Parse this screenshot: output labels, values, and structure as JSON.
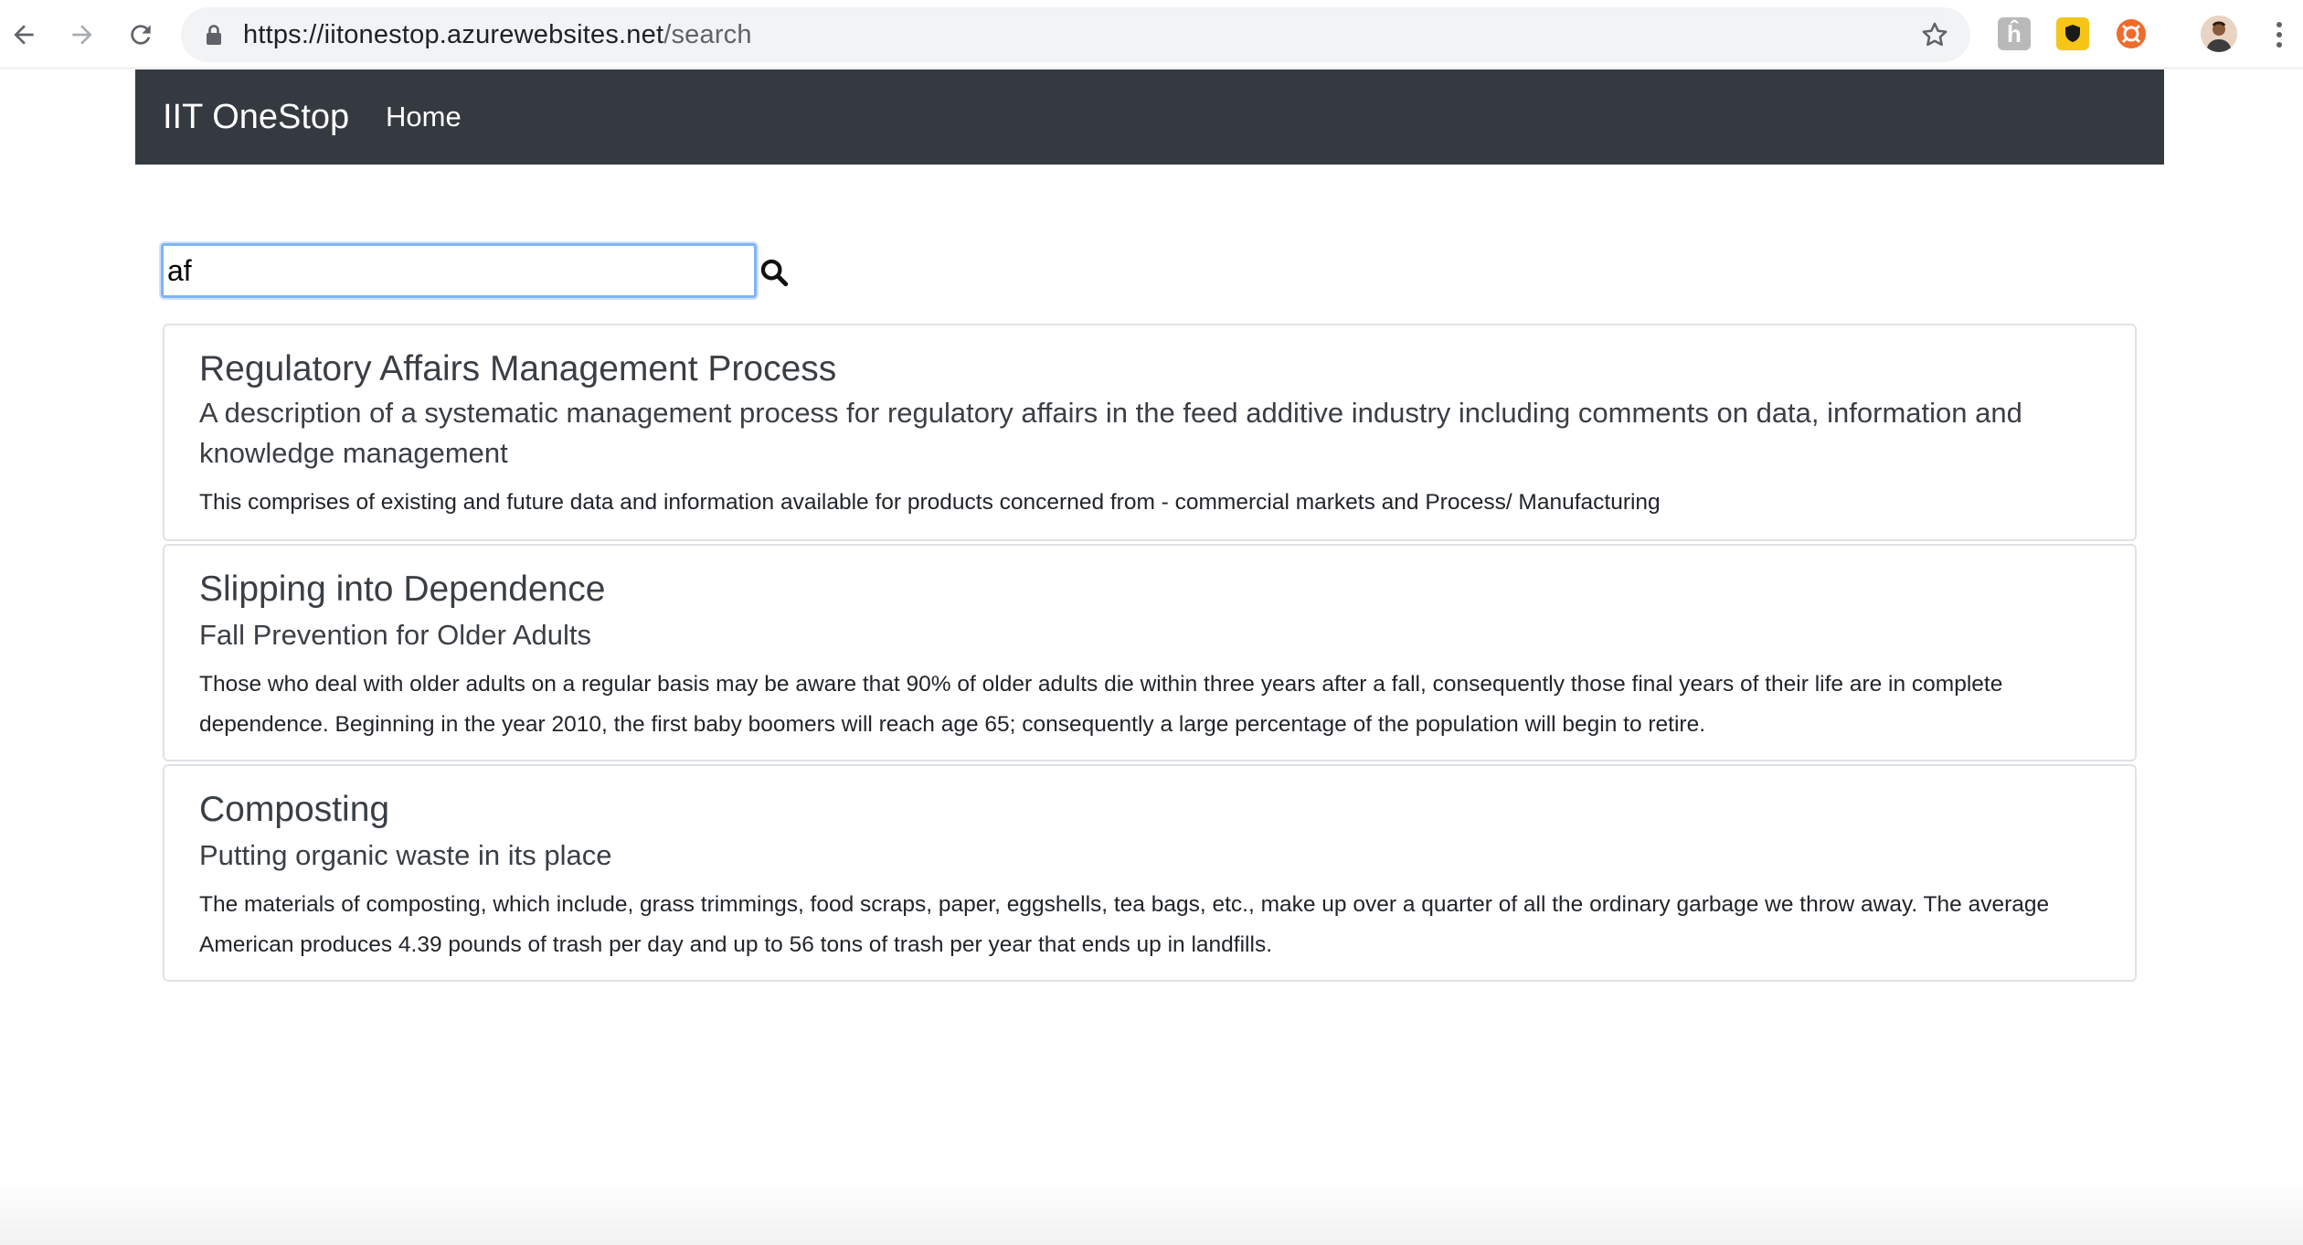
{
  "browser": {
    "url_scheme": "https://",
    "url_host": "iitonestop.azurewebsites.net",
    "url_path": "/search",
    "extensions": [
      "h-extension-icon",
      "shield-extension-icon",
      "orange-extension-icon"
    ],
    "icons": {
      "back": "back-arrow-icon",
      "forward": "forward-arrow-icon",
      "reload": "reload-icon",
      "lock": "lock-icon",
      "bookmark": "star-icon",
      "menu": "more-vert-icon"
    }
  },
  "navbar": {
    "brand": "IIT OneStop",
    "links": [
      "Home"
    ],
    "background": "#343a40"
  },
  "search": {
    "value": "af",
    "button_icon": "search-icon",
    "focus_color": "#7fb3f5"
  },
  "results": [
    {
      "title": "Regulatory Affairs Management Process",
      "subtitle": "A description of a systematic management process for regulatory affairs in the feed additive industry including comments on data, information and knowledge management",
      "text": "This comprises of existing and future data and information available for products concerned from - commercial markets and Process/ Manufacturing"
    },
    {
      "title": "Slipping into Dependence",
      "subtitle": "Fall Prevention for Older Adults",
      "text": "Those who deal with older adults on a regular basis may be aware that 90% of older adults die within three years after a fall, consequently those final years of their life are in complete dependence. Beginning in the year 2010, the first baby boomers will reach age 65; consequently a large percentage of the population will begin to retire."
    },
    {
      "title": "Composting",
      "subtitle": "Putting organic waste in its place",
      "text": "The materials of composting, which include, grass trimmings, food scraps, paper, eggshells, tea bags, etc., make up over a quarter of all the ordinary garbage we throw away. The average American produces 4.39 pounds of trash per day and up to 56 tons of trash per year that ends up in landfills."
    }
  ]
}
